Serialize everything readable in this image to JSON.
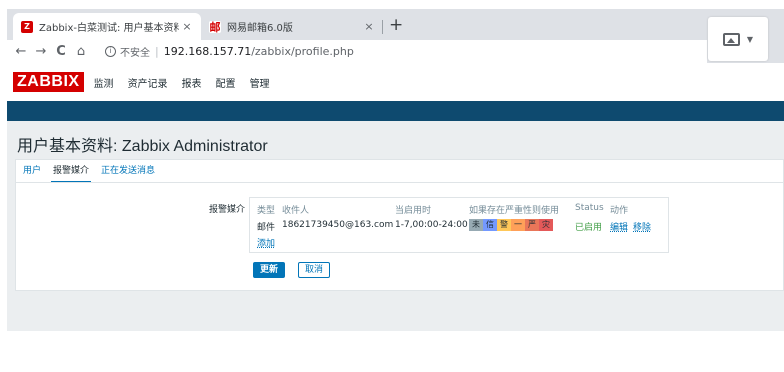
{
  "browser": {
    "tabs": [
      {
        "favicon": "Z",
        "title": "Zabbix-白菜测试: 用户基本资料",
        "close": "×"
      },
      {
        "favicon": "邮",
        "title": "网易邮箱6.0版",
        "close": "×"
      }
    ],
    "new_tab": "+",
    "nav": {
      "back": "←",
      "forward": "→",
      "reload": "C",
      "home": "⌂"
    },
    "info_icon": "i",
    "insecure_label": "不安全",
    "url_host": "192.168.157.71",
    "url_path": "/zabbix/profile.php",
    "extension_icon": "image-icon",
    "extension_caret": "▼"
  },
  "zabbix": {
    "logo": "ZABBIX",
    "menu": [
      "监测",
      "资产记录",
      "报表",
      "配置",
      "管理"
    ],
    "page_title": "用户基本资料: Zabbix Administrator",
    "tabs": [
      "用户",
      "报警媒介",
      "正在发送消息"
    ],
    "active_tab": "报警媒介",
    "form_label": "报警媒介",
    "media_table": {
      "headers": [
        "类型",
        "收件人",
        "当启用时",
        "如果存在严重性则使用",
        "Status",
        "动作"
      ],
      "row": {
        "type": "邮件",
        "recipient": "18621739450@163.com",
        "when_active": "1-7,00:00-24:00",
        "severities": [
          {
            "label": "未",
            "color": "#97aab3"
          },
          {
            "label": "信",
            "color": "#7499ff"
          },
          {
            "label": "警",
            "color": "#ffc859"
          },
          {
            "label": "一",
            "color": "#ffa059"
          },
          {
            "label": "严",
            "color": "#e97659"
          },
          {
            "label": "灾",
            "color": "#e45959"
          }
        ],
        "status": "已启用",
        "edit": "编辑",
        "remove": "移除"
      },
      "add_link": "添加"
    },
    "buttons": {
      "update": "更新",
      "cancel": "取消"
    }
  }
}
